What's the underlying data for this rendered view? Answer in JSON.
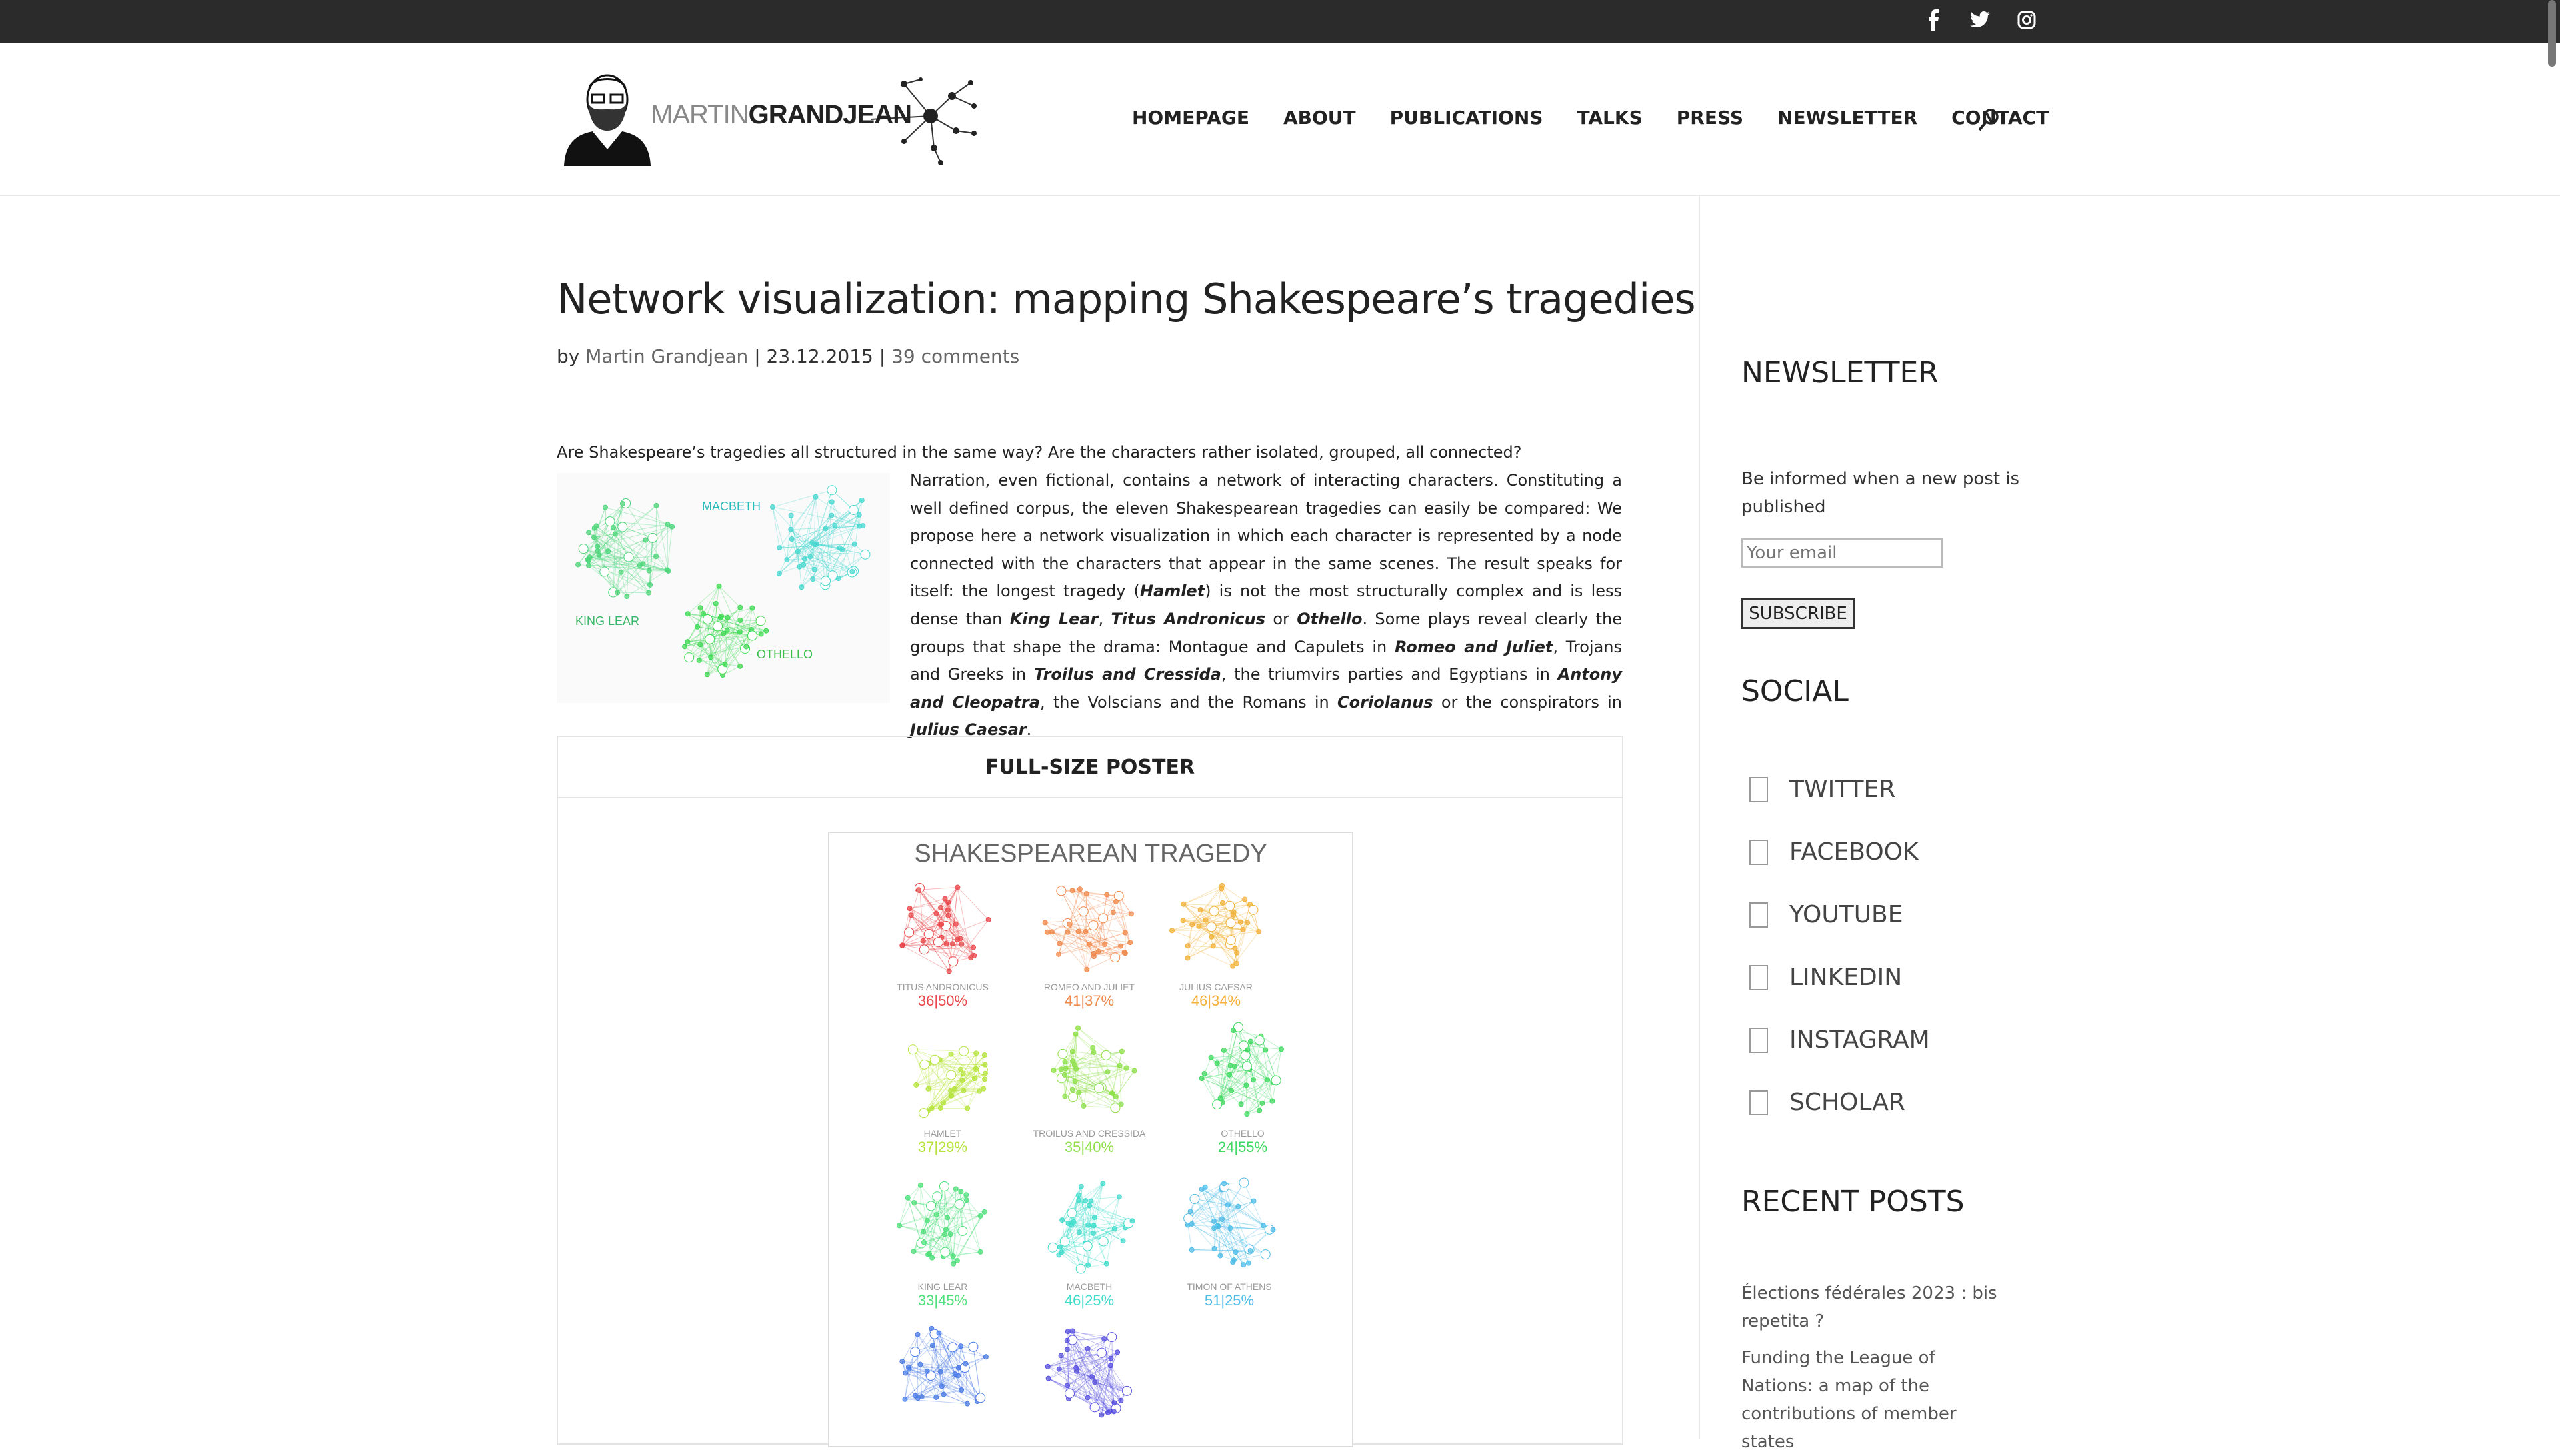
{
  "topbar": {
    "social": [
      "facebook-icon",
      "twitter-icon",
      "instagram-icon"
    ]
  },
  "header": {
    "logo": {
      "first": "MARTIN",
      "last": "GRANDJEAN"
    },
    "nav": [
      "HOMEPAGE",
      "ABOUT",
      "PUBLICATIONS",
      "TALKS",
      "PRESS",
      "NEWSLETTER",
      "CONTACT"
    ]
  },
  "post": {
    "title": "Network visualization: mapping Shakespeare’s tragedies",
    "by": "by",
    "author": "Martin Grandjean",
    "date": "23.12.2015",
    "sep": "|",
    "comments": "39 comments",
    "intro": "Are Shakespeare’s tragedies all structured in the same way? Are the characters rather isolated, grouped, all connected?",
    "thumb_labels": {
      "macbeth": "MACBETH",
      "kinglear": "KING LEAR",
      "othello": "OTHELLO"
    },
    "body": {
      "p1": "Narration, even fictional, contains a network of interacting characters. Constituting a well defined corpus, the eleven Shakespearean tragedies can easily be compared: We propose here a network visualization in which each character is represented by a node connected with the characters that appear in the same scenes. The result speaks for itself: the longest tragedy (",
      "hamlet": "Hamlet",
      "p2": ") is not the most structurally complex and is less dense than ",
      "kinglear": "King Lear",
      "c1": ", ",
      "titus": "Titus Andronicus",
      "or": " or ",
      "othello": "Othello",
      "p3": ". Some plays reveal clearly the groups that shape the drama: Montague and Capulets in ",
      "romeo": "Romeo and Juliet",
      "p4": ", Trojans and Greeks in ",
      "troilus": "Troilus and Cressida",
      "p5": ", the triumvirs parties and Egyptians in ",
      "antony": "Antony and Cleopatra",
      "p6": ", the Volscians and the Romans in ",
      "coriolanus": "Coriolanus",
      "p7": " or the conspirators in ",
      "caesar": "Julius Caesar",
      "p8": "."
    },
    "poster_header": "FULL-SIZE POSTER",
    "poster": {
      "title": "SHAKESPEAREAN TRAGEDY",
      "plays": [
        {
          "name": "TITUS ANDRONICUS",
          "num": "36|50%",
          "color": "#e8484b"
        },
        {
          "name": "ROMEO AND JULIET",
          "num": "41|37%",
          "color": "#f0884a"
        },
        {
          "name": "JULIUS CAESAR",
          "num": "46|34%",
          "color": "#f2b23a"
        },
        {
          "name": "HAMLET",
          "num": "37|29%",
          "color": "#b6e43c"
        },
        {
          "name": "TROILUS AND CRESSIDA",
          "num": "35|40%",
          "color": "#8ee04a"
        },
        {
          "name": "OTHELLO",
          "num": "24|55%",
          "color": "#3fd960"
        },
        {
          "name": "KING LEAR",
          "num": "33|45%",
          "color": "#4ee07a"
        },
        {
          "name": "MACBETH",
          "num": "46|25%",
          "color": "#3fdccb"
        },
        {
          "name": "TIMON OF ATHENS",
          "num": "51|25%",
          "color": "#4fbde8"
        },
        {
          "name": "",
          "num": "",
          "color": "#4a7be6"
        },
        {
          "name": "",
          "num": "",
          "color": "#5a52e0"
        }
      ]
    }
  },
  "sidebar": {
    "newsletter_title": "NEWSLETTER",
    "newsletter_text": "Be informed when a new post is published",
    "email_placeholder": "Your email",
    "subscribe": "SUBSCRIBE",
    "social_title": "SOCIAL",
    "social": [
      "TWITTER",
      "FACEBOOK",
      "YOUTUBE",
      "LINKEDIN",
      "INSTAGRAM",
      "SCHOLAR"
    ],
    "recent_title": "RECENT POSTS",
    "recent": [
      "Élections fédérales 2023 : bis repetita ?",
      "Funding the League of Nations: a map of the contributions of member states"
    ]
  }
}
